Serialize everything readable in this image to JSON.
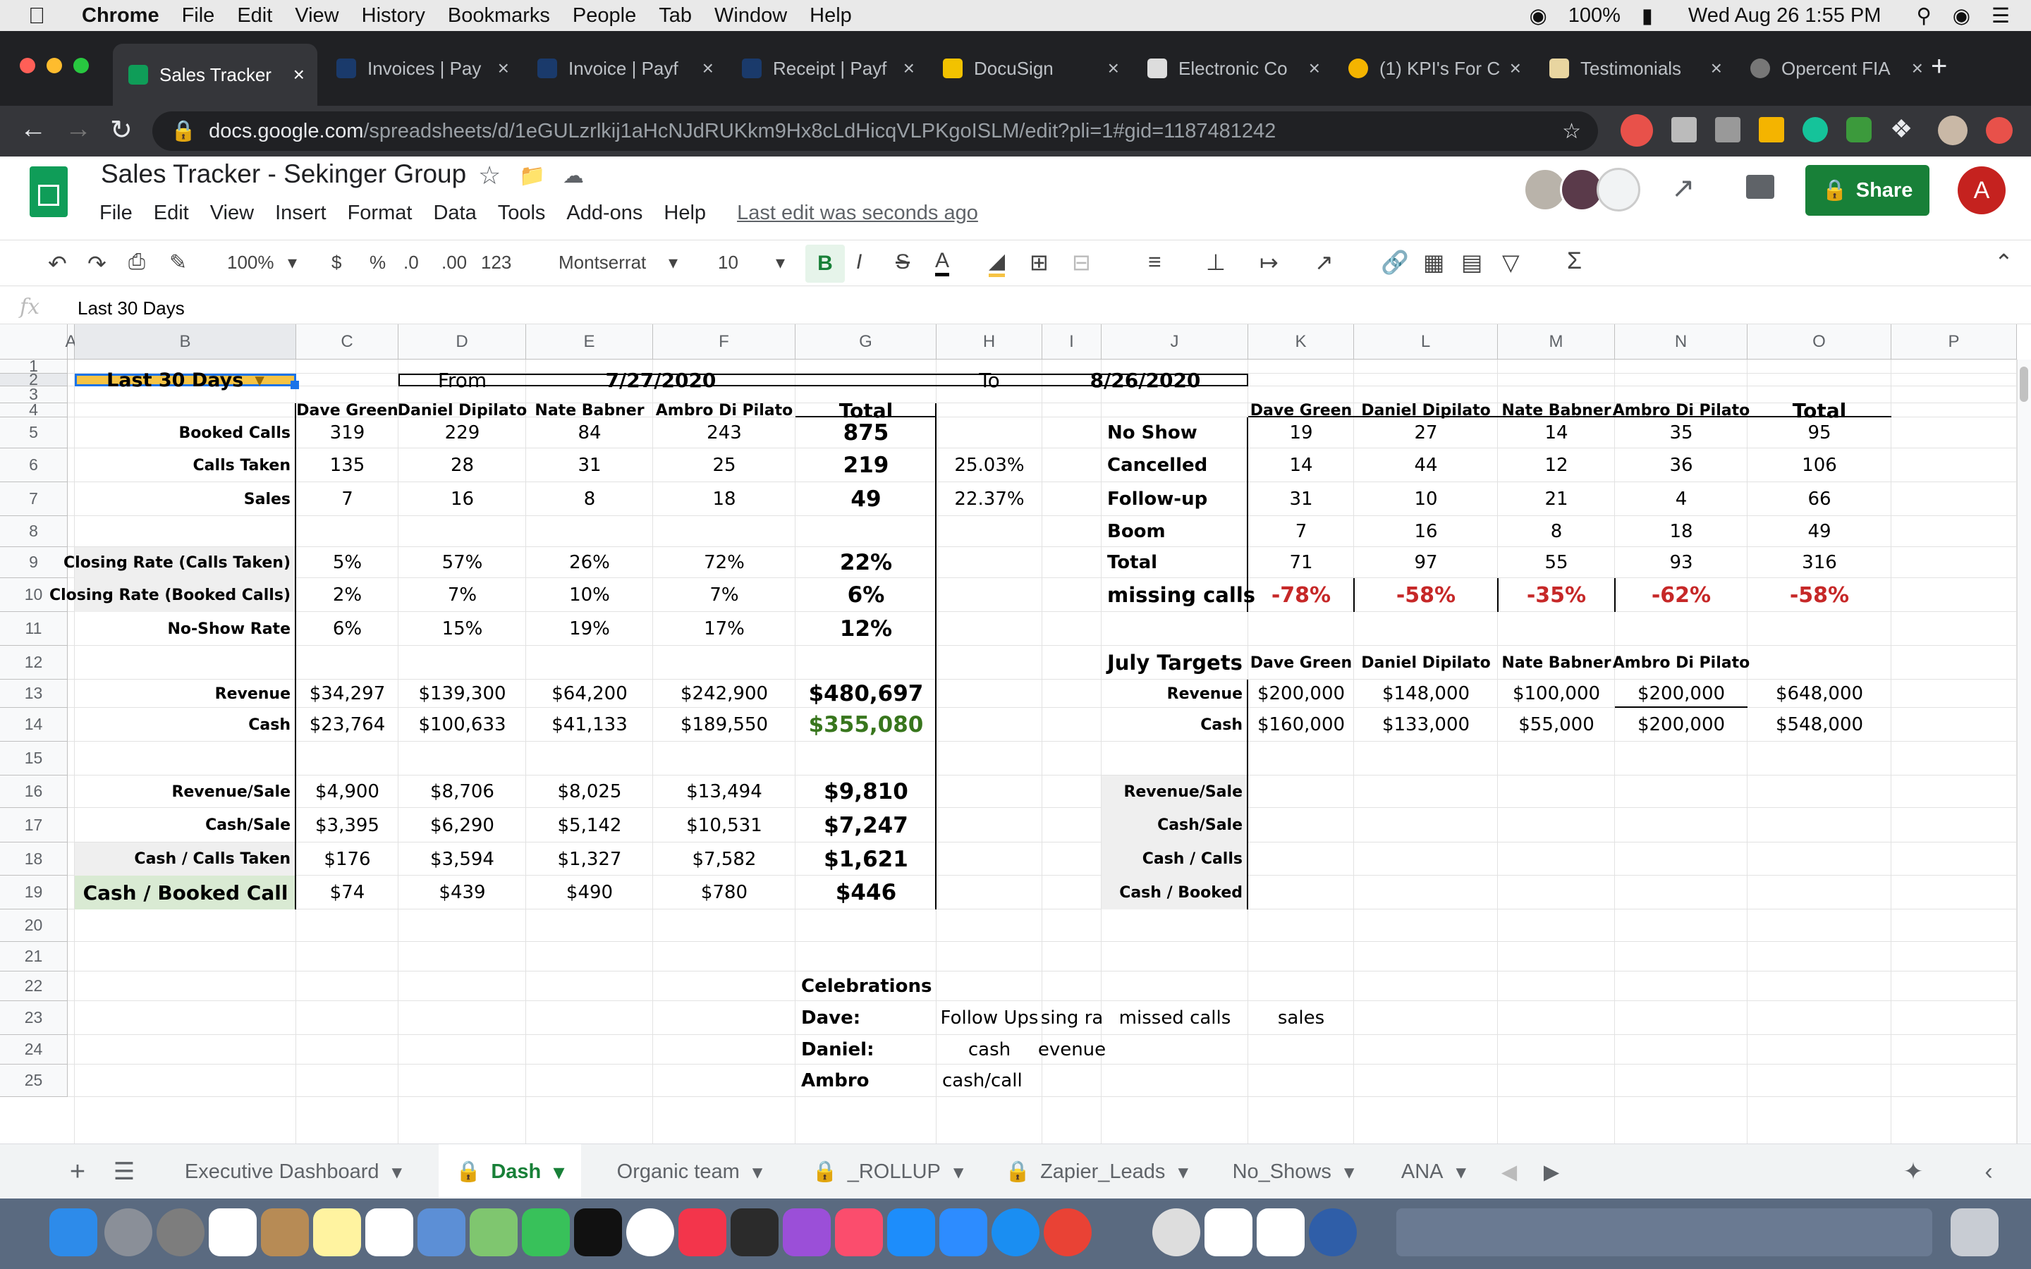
{
  "menubar": {
    "app": "Chrome",
    "items": [
      "File",
      "Edit",
      "View",
      "History",
      "Bookmarks",
      "People",
      "Tab",
      "Window",
      "Help"
    ],
    "battery": "100%",
    "datetime": "Wed Aug 26  1:55 PM"
  },
  "tabs": [
    {
      "label": "Sales Tracker",
      "active": true,
      "color": "#0f9d58"
    },
    {
      "label": "Invoices | Pay",
      "color": "#1a3a6b"
    },
    {
      "label": "Invoice | Payf",
      "color": "#1a3a6b"
    },
    {
      "label": "Receipt | Payf",
      "color": "#1a3a6b"
    },
    {
      "label": "DocuSign",
      "color": "#f2c200"
    },
    {
      "label": "Electronic Co",
      "color": "#dddddd"
    },
    {
      "label": "(1) KPI's For C",
      "color": "#f4b400"
    },
    {
      "label": "Testimonials",
      "color": "#e8d5a0"
    },
    {
      "label": "Opercent FIA",
      "color": "#777777"
    }
  ],
  "url": {
    "domain": "docs.google.com",
    "path": "/spreadsheets/d/1eGULzrlkij1aHcNJdRUKkm9Hx8cLdHicqVLPKgoISLM/edit?pli=1#gid=1187481242"
  },
  "doc": {
    "title": "Sales Tracker - Sekinger Group",
    "menus": [
      "File",
      "Edit",
      "View",
      "Insert",
      "Format",
      "Data",
      "Tools",
      "Add-ons",
      "Help"
    ],
    "last_edit": "Last edit was seconds ago",
    "share": "Share",
    "avatar": "A"
  },
  "toolbar": {
    "zoom": "100%",
    "currency": "$",
    "percent": "%",
    "dec_minus": ".0",
    "dec_plus": ".00",
    "format": "123",
    "font": "Montserrat",
    "size": "10",
    "bold": "B",
    "italic": "I",
    "strike": "S",
    "textcolor": "A"
  },
  "formula": {
    "fx": "fx",
    "value": "Last 30 Days"
  },
  "columns": [
    "A",
    "B",
    "C",
    "D",
    "E",
    "F",
    "G",
    "H",
    "I",
    "J",
    "K",
    "L",
    "M",
    "N",
    "O",
    "P"
  ],
  "rows": [
    "1",
    "2",
    "3",
    "4",
    "5",
    "6",
    "7",
    "8",
    "9",
    "10",
    "11",
    "12",
    "13",
    "14",
    "15",
    "16",
    "17",
    "18",
    "19",
    "20",
    "21",
    "22",
    "23",
    "24",
    "25"
  ],
  "top": {
    "period": "Last 30 Days",
    "from_label": "From",
    "from": "7/27/2020",
    "to_label": "To",
    "to": "8/26/2020"
  },
  "left_table": {
    "headers": [
      "Dave Green",
      "Daniel Dipilato",
      "Nate Babner",
      "Ambro Di Pilato",
      "Total"
    ],
    "rows": [
      {
        "label": "Booked Calls",
        "values": [
          "319",
          "229",
          "84",
          "243",
          "875"
        ],
        "extra": ""
      },
      {
        "label": "Calls Taken",
        "values": [
          "135",
          "28",
          "31",
          "25",
          "219"
        ],
        "extra": "25.03%"
      },
      {
        "label": "Sales",
        "values": [
          "7",
          "16",
          "8",
          "18",
          "49"
        ],
        "extra": "22.37%"
      },
      {
        "label": "",
        "values": [
          "",
          "",
          "",
          "",
          ""
        ],
        "extra": ""
      },
      {
        "label": "Closing Rate (Calls Taken)",
        "values": [
          "5%",
          "57%",
          "26%",
          "72%",
          "22%"
        ],
        "extra": ""
      },
      {
        "label": "Closing Rate (Booked Calls)",
        "values": [
          "2%",
          "7%",
          "10%",
          "7%",
          "6%"
        ],
        "extra": ""
      },
      {
        "label": "No-Show Rate",
        "values": [
          "6%",
          "15%",
          "19%",
          "17%",
          "12%"
        ],
        "extra": ""
      },
      {
        "label": "",
        "values": [
          "",
          "",
          "",
          "",
          ""
        ],
        "extra": ""
      },
      {
        "label": "Revenue",
        "values": [
          "$34,297",
          "$139,300",
          "$64,200",
          "$242,900",
          "$480,697"
        ],
        "extra": ""
      },
      {
        "label": "Cash",
        "values": [
          "$23,764",
          "$100,633",
          "$41,133",
          "$189,550",
          "$355,080"
        ],
        "extra": ""
      },
      {
        "label": "",
        "values": [
          "",
          "",
          "",
          "",
          ""
        ],
        "extra": ""
      },
      {
        "label": "Revenue/Sale",
        "values": [
          "$4,900",
          "$8,706",
          "$8,025",
          "$13,494",
          "$9,810"
        ],
        "extra": ""
      },
      {
        "label": "Cash/Sale",
        "values": [
          "$3,395",
          "$6,290",
          "$5,142",
          "$10,531",
          "$7,247"
        ],
        "extra": ""
      },
      {
        "label": "Cash / Calls Taken",
        "values": [
          "$176",
          "$3,594",
          "$1,327",
          "$7,582",
          "$1,621"
        ],
        "extra": ""
      },
      {
        "label": "Cash / Booked Call",
        "values": [
          "$74",
          "$439",
          "$490",
          "$780",
          "$446"
        ],
        "extra": ""
      }
    ]
  },
  "right_table": {
    "headers": [
      "Dave Green",
      "Daniel Dipilato",
      "Nate Babner",
      "Ambro Di Pilato",
      "Total"
    ],
    "rows": [
      {
        "label": "No Show",
        "values": [
          "19",
          "27",
          "14",
          "35",
          "95"
        ]
      },
      {
        "label": "Cancelled",
        "values": [
          "14",
          "44",
          "12",
          "36",
          "106"
        ]
      },
      {
        "label": "Follow-up",
        "values": [
          "31",
          "10",
          "21",
          "4",
          "66"
        ]
      },
      {
        "label": "Boom",
        "values": [
          "7",
          "16",
          "8",
          "18",
          "49"
        ]
      },
      {
        "label": "Total",
        "values": [
          "71",
          "97",
          "55",
          "93",
          "316"
        ]
      },
      {
        "label": "missing calls",
        "values": [
          "-78%",
          "-58%",
          "-35%",
          "-62%",
          "-58%"
        ]
      }
    ]
  },
  "targets": {
    "title": "July Targets",
    "headers": [
      "Dave Green",
      "Daniel Dipilato",
      "Nate Babner",
      "Ambro Di Pilato"
    ],
    "rows": [
      {
        "label": "Revenue",
        "values": [
          "$200,000",
          "$148,000",
          "$100,000",
          "$200,000",
          "$648,000"
        ]
      },
      {
        "label": "Cash",
        "values": [
          "$160,000",
          "$133,000",
          "$55,000",
          "$200,000",
          "$548,000"
        ]
      }
    ],
    "labels2": [
      "Revenue/Sale",
      "Cash/Sale",
      "Cash / Calls",
      "Cash / Booked"
    ]
  },
  "celebrations": {
    "title": "Celebrations",
    "names": [
      "Dave:",
      "Daniel:",
      "Ambro"
    ],
    "r23": [
      "Follow Ups",
      "sing ra",
      "missed calls",
      "sales"
    ],
    "r24": [
      "cash",
      "evenue"
    ],
    "r25": [
      "cash/call"
    ]
  },
  "sheets": [
    "Executive Dashboard",
    "Dash",
    "Organic team",
    "_ROLLUP",
    "Zapier_Leads",
    "No_Shows",
    "ANA"
  ],
  "colors": {
    "selected_fill": "#f6c344",
    "accent_green": "#188038",
    "red": "#c62828"
  }
}
